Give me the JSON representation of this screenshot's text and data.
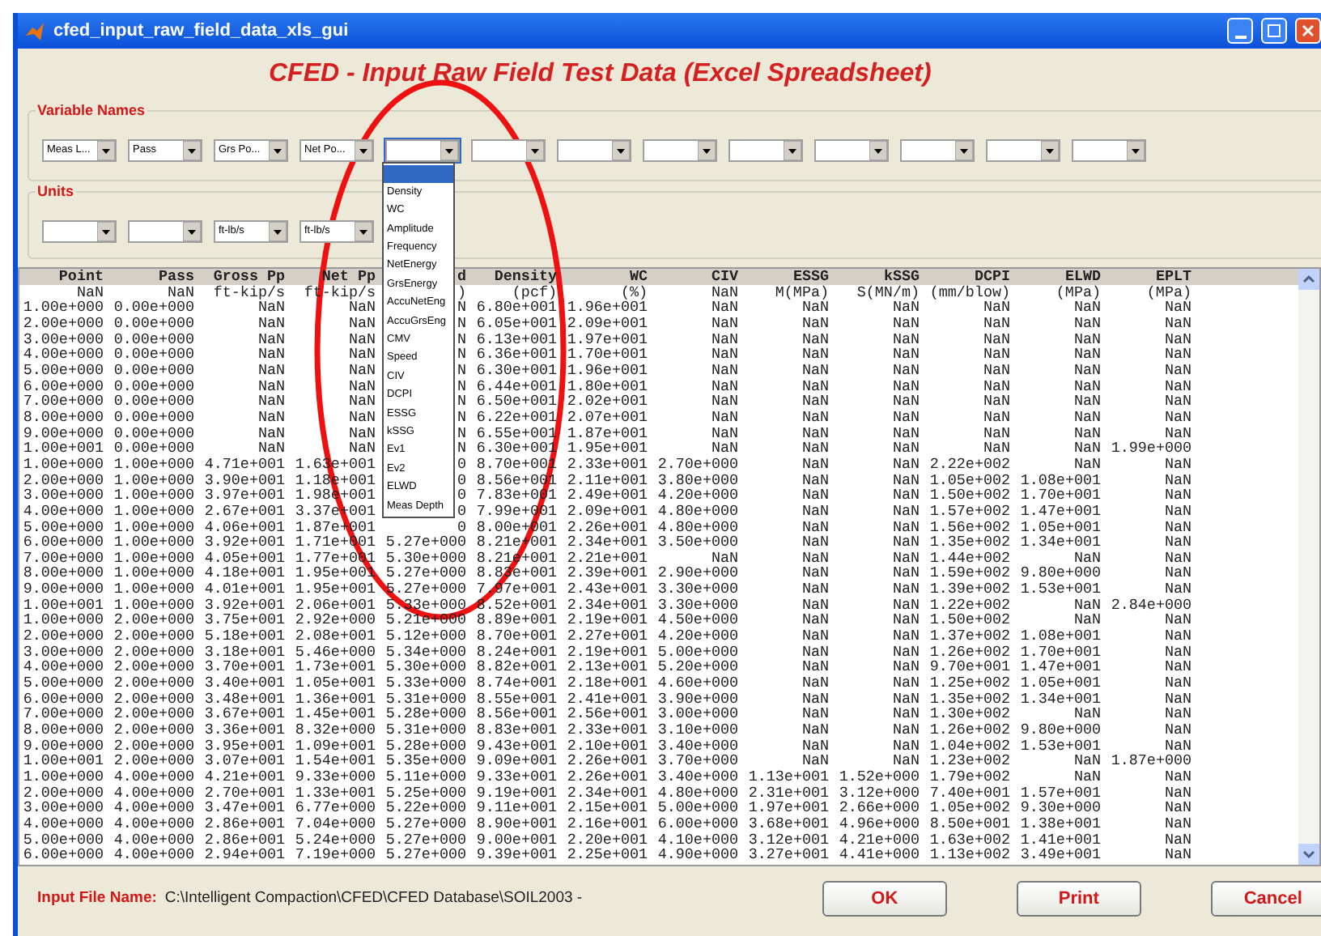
{
  "window": {
    "title": "cfed_input_raw_field_data_xls_gui"
  },
  "heading": "CFED - Input Raw Field Test Data (Excel Spreadsheet)",
  "variable_names": {
    "label": "Variable Names",
    "selects": [
      {
        "value": "Meas L...",
        "open": false
      },
      {
        "value": "Pass",
        "open": false
      },
      {
        "value": "Grs Po...",
        "open": false
      },
      {
        "value": "Net Po...",
        "open": false
      },
      {
        "open": true,
        "options": [
          {
            "selected": true
          },
          {
            "label": "Density",
            "selected": false
          },
          {
            "label": "WC",
            "selected": false
          },
          {
            "label": "Amplitude",
            "selected": false
          },
          {
            "label": "Frequency",
            "selected": false
          },
          {
            "label": "NetEnergy",
            "selected": false
          },
          {
            "label": "GrsEnergy",
            "selected": false
          },
          {
            "label": "AccuNetEng",
            "selected": false
          },
          {
            "label": "AccuGrsEng",
            "selected": false
          },
          {
            "label": "CMV",
            "selected": false
          },
          {
            "label": "Speed",
            "selected": false
          },
          {
            "label": "CIV",
            "selected": false
          },
          {
            "label": "DCPI",
            "selected": false
          },
          {
            "label": "ESSG",
            "selected": false
          },
          {
            "label": "kSSG",
            "selected": false
          },
          {
            "label": "Ev1",
            "selected": false
          },
          {
            "label": "Ev2",
            "selected": false
          },
          {
            "label": "ELWD",
            "selected": false
          },
          {
            "label": "Meas Depth",
            "selected": false
          }
        ]
      },
      {
        "open": false
      },
      {
        "open": false
      },
      {
        "open": false
      },
      {
        "open": false
      },
      {
        "open": false
      },
      {
        "open": false
      },
      {
        "open": false
      },
      {
        "open": false
      }
    ]
  },
  "units": {
    "label": "Units",
    "selects": [
      {
        "open": false
      },
      {
        "open": false
      },
      {
        "value": "ft-lb/s",
        "open": false
      },
      {
        "value": "ft-lb/s",
        "open": false
      }
    ]
  },
  "table": {
    "columns": [
      {
        "header": "Point",
        "unit": "NaN"
      },
      {
        "header": "Pass",
        "unit": "NaN"
      },
      {
        "header": "Gross Pp",
        "unit": "ft-kip/s"
      },
      {
        "header": "Net Pp",
        "unit": "ft-kip/s"
      },
      {
        "header": "d",
        "unit": ")"
      },
      {
        "header": "Density",
        "unit": "(pcf)"
      },
      {
        "header": "WC",
        "unit": "(%)"
      },
      {
        "header": "CIV",
        "unit": "NaN"
      },
      {
        "header": "ESSG",
        "unit": "M(MPa)"
      },
      {
        "header": "kSSG",
        "unit": "S(MN/m)"
      },
      {
        "header": "DCPI",
        "unit": "(mm/blow)"
      },
      {
        "header": "ELWD",
        "unit": "(MPa)"
      },
      {
        "header": "EPLT",
        "unit": "(MPa)"
      }
    ],
    "rows": [
      [
        "1.00e+000",
        "0.00e+000",
        "NaN",
        "NaN",
        "N",
        "6.80e+001",
        "1.96e+001",
        "NaN",
        "NaN",
        "NaN",
        "NaN",
        "NaN",
        "NaN"
      ],
      [
        "2.00e+000",
        "0.00e+000",
        "NaN",
        "NaN",
        "N",
        "6.05e+001",
        "2.09e+001",
        "NaN",
        "NaN",
        "NaN",
        "NaN",
        "NaN",
        "NaN"
      ],
      [
        "3.00e+000",
        "0.00e+000",
        "NaN",
        "NaN",
        "N",
        "6.13e+001",
        "1.97e+001",
        "NaN",
        "NaN",
        "NaN",
        "NaN",
        "NaN",
        "NaN"
      ],
      [
        "4.00e+000",
        "0.00e+000",
        "NaN",
        "NaN",
        "N",
        "6.36e+001",
        "1.70e+001",
        "NaN",
        "NaN",
        "NaN",
        "NaN",
        "NaN",
        "NaN"
      ],
      [
        "5.00e+000",
        "0.00e+000",
        "NaN",
        "NaN",
        "N",
        "6.30e+001",
        "1.96e+001",
        "NaN",
        "NaN",
        "NaN",
        "NaN",
        "NaN",
        "NaN"
      ],
      [
        "6.00e+000",
        "0.00e+000",
        "NaN",
        "NaN",
        "N",
        "6.44e+001",
        "1.80e+001",
        "NaN",
        "NaN",
        "NaN",
        "NaN",
        "NaN",
        "NaN"
      ],
      [
        "7.00e+000",
        "0.00e+000",
        "NaN",
        "NaN",
        "N",
        "6.50e+001",
        "2.02e+001",
        "NaN",
        "NaN",
        "NaN",
        "NaN",
        "NaN",
        "NaN"
      ],
      [
        "8.00e+000",
        "0.00e+000",
        "NaN",
        "NaN",
        "N",
        "6.22e+001",
        "2.07e+001",
        "NaN",
        "NaN",
        "NaN",
        "NaN",
        "NaN",
        "NaN"
      ],
      [
        "9.00e+000",
        "0.00e+000",
        "NaN",
        "NaN",
        "N",
        "6.55e+001",
        "1.87e+001",
        "NaN",
        "NaN",
        "NaN",
        "NaN",
        "NaN",
        "NaN"
      ],
      [
        "1.00e+001",
        "0.00e+000",
        "NaN",
        "NaN",
        "N",
        "6.30e+001",
        "1.95e+001",
        "NaN",
        "NaN",
        "NaN",
        "NaN",
        "NaN",
        "1.99e+000"
      ],
      [
        "1.00e+000",
        "1.00e+000",
        "4.71e+001",
        "1.63e+001",
        "0",
        "8.70e+001",
        "2.33e+001",
        "2.70e+000",
        "NaN",
        "NaN",
        "2.22e+002",
        "NaN",
        "NaN"
      ],
      [
        "2.00e+000",
        "1.00e+000",
        "3.90e+001",
        "1.18e+001",
        "0",
        "8.56e+001",
        "2.11e+001",
        "3.80e+000",
        "NaN",
        "NaN",
        "1.05e+002",
        "1.08e+001",
        "NaN"
      ],
      [
        "3.00e+000",
        "1.00e+000",
        "3.97e+001",
        "1.98e+001",
        "0",
        "7.83e+001",
        "2.49e+001",
        "4.20e+000",
        "NaN",
        "NaN",
        "1.50e+002",
        "1.70e+001",
        "NaN"
      ],
      [
        "4.00e+000",
        "1.00e+000",
        "2.67e+001",
        "3.37e+001",
        "0",
        "7.99e+001",
        "2.09e+001",
        "4.80e+000",
        "NaN",
        "NaN",
        "1.57e+002",
        "1.47e+001",
        "NaN"
      ],
      [
        "5.00e+000",
        "1.00e+000",
        "4.06e+001",
        "1.87e+001",
        "0",
        "8.00e+001",
        "2.26e+001",
        "4.80e+000",
        "NaN",
        "NaN",
        "1.56e+002",
        "1.05e+001",
        "NaN"
      ],
      [
        "6.00e+000",
        "1.00e+000",
        "3.92e+001",
        "1.71e+001",
        "5.27e+000",
        "8.21e+001",
        "2.34e+001",
        "3.50e+000",
        "NaN",
        "NaN",
        "1.35e+002",
        "1.34e+001",
        "NaN"
      ],
      [
        "7.00e+000",
        "1.00e+000",
        "4.05e+001",
        "1.77e+001",
        "5.30e+000",
        "8.21e+001",
        "2.21e+001",
        "NaN",
        "NaN",
        "NaN",
        "1.44e+002",
        "NaN",
        "NaN"
      ],
      [
        "8.00e+000",
        "1.00e+000",
        "4.18e+001",
        "1.95e+001",
        "5.27e+000",
        "8.83e+001",
        "2.39e+001",
        "2.90e+000",
        "NaN",
        "NaN",
        "1.59e+002",
        "9.80e+000",
        "NaN"
      ],
      [
        "9.00e+000",
        "1.00e+000",
        "4.01e+001",
        "1.95e+001",
        "5.27e+000",
        "7.97e+001",
        "2.43e+001",
        "3.30e+000",
        "NaN",
        "NaN",
        "1.39e+002",
        "1.53e+001",
        "NaN"
      ],
      [
        "1.00e+001",
        "1.00e+000",
        "3.92e+001",
        "2.06e+001",
        "5.33e+000",
        "8.52e+001",
        "2.34e+001",
        "3.30e+000",
        "NaN",
        "NaN",
        "1.22e+002",
        "NaN",
        "2.84e+000"
      ],
      [
        "1.00e+000",
        "2.00e+000",
        "3.75e+001",
        "2.92e+000",
        "5.21e+000",
        "8.89e+001",
        "2.19e+001",
        "4.50e+000",
        "NaN",
        "NaN",
        "1.50e+002",
        "NaN",
        "NaN"
      ],
      [
        "2.00e+000",
        "2.00e+000",
        "5.18e+001",
        "2.08e+001",
        "5.12e+000",
        "8.70e+001",
        "2.27e+001",
        "4.20e+000",
        "NaN",
        "NaN",
        "1.37e+002",
        "1.08e+001",
        "NaN"
      ],
      [
        "3.00e+000",
        "2.00e+000",
        "3.18e+001",
        "5.46e+000",
        "5.34e+000",
        "8.24e+001",
        "2.19e+001",
        "5.00e+000",
        "NaN",
        "NaN",
        "1.26e+002",
        "1.70e+001",
        "NaN"
      ],
      [
        "4.00e+000",
        "2.00e+000",
        "3.70e+001",
        "1.73e+001",
        "5.30e+000",
        "8.82e+001",
        "2.13e+001",
        "5.20e+000",
        "NaN",
        "NaN",
        "9.70e+001",
        "1.47e+001",
        "NaN"
      ],
      [
        "5.00e+000",
        "2.00e+000",
        "3.40e+001",
        "1.05e+001",
        "5.33e+000",
        "8.74e+001",
        "2.18e+001",
        "4.60e+000",
        "NaN",
        "NaN",
        "1.25e+002",
        "1.05e+001",
        "NaN"
      ],
      [
        "6.00e+000",
        "2.00e+000",
        "3.48e+001",
        "1.36e+001",
        "5.31e+000",
        "8.55e+001",
        "2.41e+001",
        "3.90e+000",
        "NaN",
        "NaN",
        "1.35e+002",
        "1.34e+001",
        "NaN"
      ],
      [
        "7.00e+000",
        "2.00e+000",
        "3.67e+001",
        "1.45e+001",
        "5.28e+000",
        "8.56e+001",
        "2.56e+001",
        "3.00e+000",
        "NaN",
        "NaN",
        "1.30e+002",
        "NaN",
        "NaN"
      ],
      [
        "8.00e+000",
        "2.00e+000",
        "3.36e+001",
        "8.32e+000",
        "5.31e+000",
        "8.83e+001",
        "2.33e+001",
        "3.10e+000",
        "NaN",
        "NaN",
        "1.26e+002",
        "9.80e+000",
        "NaN"
      ],
      [
        "9.00e+000",
        "2.00e+000",
        "3.95e+001",
        "1.09e+001",
        "5.28e+000",
        "9.43e+001",
        "2.10e+001",
        "3.40e+000",
        "NaN",
        "NaN",
        "1.04e+002",
        "1.53e+001",
        "NaN"
      ],
      [
        "1.00e+001",
        "2.00e+000",
        "3.07e+001",
        "1.54e+001",
        "5.35e+000",
        "9.09e+001",
        "2.26e+001",
        "3.70e+000",
        "NaN",
        "NaN",
        "1.23e+002",
        "NaN",
        "1.87e+000"
      ],
      [
        "1.00e+000",
        "4.00e+000",
        "4.21e+001",
        "9.33e+000",
        "5.11e+000",
        "9.33e+001",
        "2.26e+001",
        "3.40e+000",
        "1.13e+001",
        "1.52e+000",
        "1.79e+002",
        "NaN",
        "NaN"
      ],
      [
        "2.00e+000",
        "4.00e+000",
        "2.70e+001",
        "1.33e+001",
        "5.25e+000",
        "9.19e+001",
        "2.34e+001",
        "4.80e+000",
        "2.31e+001",
        "3.12e+000",
        "7.40e+001",
        "1.57e+001",
        "NaN"
      ],
      [
        "3.00e+000",
        "4.00e+000",
        "3.47e+001",
        "6.77e+000",
        "5.22e+000",
        "9.11e+001",
        "2.15e+001",
        "5.00e+000",
        "1.97e+001",
        "2.66e+000",
        "1.05e+002",
        "9.30e+000",
        "NaN"
      ],
      [
        "4.00e+000",
        "4.00e+000",
        "2.86e+001",
        "7.04e+000",
        "5.27e+000",
        "8.90e+001",
        "2.16e+001",
        "6.00e+000",
        "3.68e+001",
        "4.96e+000",
        "8.50e+001",
        "1.38e+001",
        "NaN"
      ],
      [
        "5.00e+000",
        "4.00e+000",
        "2.86e+001",
        "5.24e+000",
        "5.27e+000",
        "9.00e+001",
        "2.20e+001",
        "4.10e+000",
        "3.12e+001",
        "4.21e+000",
        "1.63e+002",
        "1.41e+001",
        "NaN"
      ],
      [
        "6.00e+000",
        "4.00e+000",
        "2.94e+001",
        "7.19e+000",
        "5.27e+000",
        "9.39e+001",
        "2.25e+001",
        "4.90e+000",
        "3.27e+001",
        "4.41e+000",
        "1.13e+002",
        "3.49e+001",
        "NaN"
      ]
    ]
  },
  "footer": {
    "label": "Input File Name:",
    "path": "C:\\Intelligent Compaction\\CFED\\CFED Database\\SOIL2003 -"
  },
  "buttons": [
    "OK",
    "Print",
    "Cancel"
  ]
}
